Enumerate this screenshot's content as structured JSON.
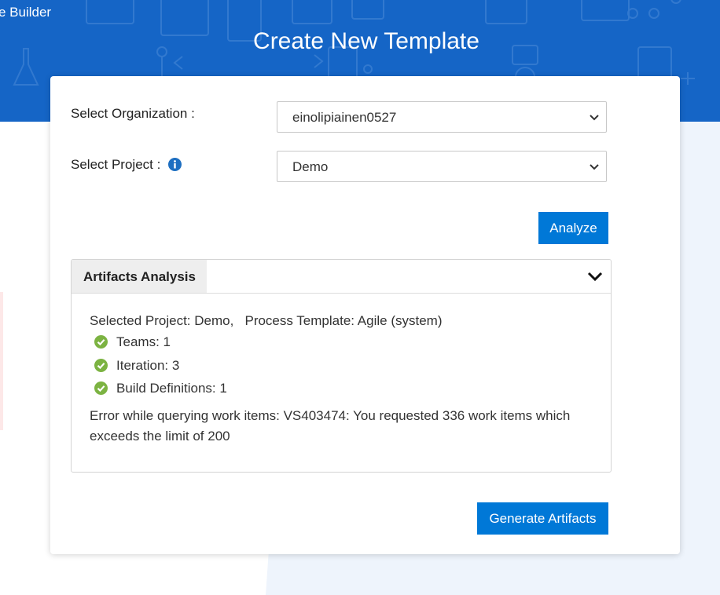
{
  "app": {
    "brand_fragment": "e Builder"
  },
  "page": {
    "title": "Create New Template"
  },
  "form": {
    "organization_label": "Select Organization :",
    "organization_value": "einolipiainen0527",
    "project_label": "Select Project :",
    "project_value": "Demo",
    "analyze_label": "Analyze"
  },
  "analysis": {
    "tab_label": "Artifacts Analysis",
    "summary": "Selected Project: Demo,   Process Template: Agile (system)",
    "items": [
      {
        "label": "Teams: 1"
      },
      {
        "label": "Iteration: 3"
      },
      {
        "label": "Build Definitions: 1"
      }
    ],
    "error": "Error while querying work items: VS403474: You requested 336 work items which exceeds the limit of 200"
  },
  "actions": {
    "generate_label": "Generate Artifacts"
  },
  "colors": {
    "banner": "#1565c6",
    "primary_button": "#0078d7",
    "check": "#7cb342",
    "info": "#1e6fc1"
  }
}
